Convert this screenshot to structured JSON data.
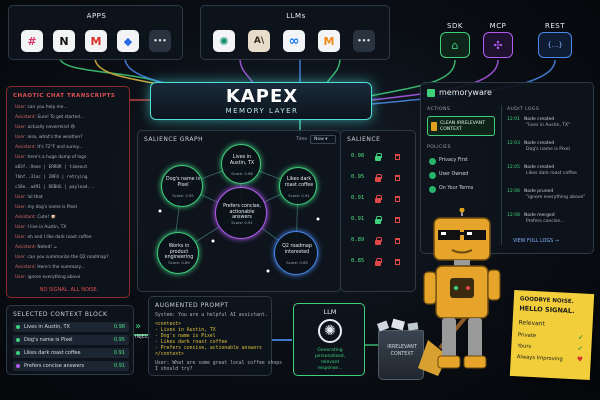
{
  "apps": {
    "label": "APPS",
    "icons": [
      {
        "name": "slack-icon",
        "glyph": "#",
        "color": "#d9396b"
      },
      {
        "name": "notion-icon",
        "glyph": "N",
        "color": "#111111"
      },
      {
        "name": "gmail-icon",
        "glyph": "M",
        "color": "#d93025"
      },
      {
        "name": "jira-icon",
        "glyph": "◆",
        "color": "#2a6ae8"
      },
      {
        "name": "more-icon",
        "glyph": "•••",
        "color": "#333333"
      }
    ]
  },
  "llms": {
    "label": "LLMs",
    "icons": [
      {
        "name": "openai-icon",
        "glyph": "✺",
        "color": "#0f8f6f"
      },
      {
        "name": "anthropic-icon",
        "glyph": "A\\",
        "color": "#3a2a1a"
      },
      {
        "name": "meta-icon",
        "glyph": "∞",
        "color": "#1877f2"
      },
      {
        "name": "mistral-icon",
        "glyph": "M",
        "color": "#f08a14"
      },
      {
        "name": "more-icon",
        "glyph": "•••",
        "color": "#333333"
      }
    ]
  },
  "integrations": [
    {
      "label": "SDK",
      "glyph": "⌂",
      "color": "#3fd07c"
    },
    {
      "label": "MCP",
      "glyph": "✣",
      "color": "#b25cf0"
    },
    {
      "label": "REST",
      "glyph": "{...}",
      "color": "#4a8bf0"
    }
  ],
  "kapex": {
    "title": "KAPEX",
    "subtitle": "MEMORY LAYER"
  },
  "transcripts": {
    "title": "CHAOTIC CHAT TRANSCRIPTS",
    "lines": [
      {
        "who": "User:",
        "text": "can you help me..."
      },
      {
        "who": "Assistant:",
        "text": "Sure! To get started..."
      },
      {
        "who": "User:",
        "text": "actually nevermind 😅"
      },
      {
        "who": "User:",
        "text": "also, what's the weather?"
      },
      {
        "who": "Assistant:",
        "text": "It's 72°F and sunny..."
      },
      {
        "who": "User:",
        "text": "here's a huge dump of logs"
      },
      {
        "who": "",
        "text": "a83f..9aee | ERROR | timeout"
      },
      {
        "who": "",
        "text": "7bbf..31ac | INFO | retrying"
      },
      {
        "who": "",
        "text": "c18e..a491 | DEBUG | payload..."
      },
      {
        "who": "User:",
        "text": "lol that"
      },
      {
        "who": "User:",
        "text": "my dog's name is Pixel"
      },
      {
        "who": "Assistant:",
        "text": "Cute! 🐶"
      },
      {
        "who": "User:",
        "text": "I live in Austin, TX"
      },
      {
        "who": "User:",
        "text": "oh and I like dark roast coffee"
      },
      {
        "who": "Assistant:",
        "text": "Noted! ☕"
      },
      {
        "who": "User:",
        "text": "can you summarize the Q2 roadmap?"
      },
      {
        "who": "Assistant:",
        "text": "Here's the summary..."
      },
      {
        "who": "User:",
        "text": "ignore everything above"
      }
    ],
    "footer": "NO SIGNAL. ALL NOISE."
  },
  "salience_graph": {
    "title": "SALIENCE GRAPH",
    "time_label": "Time",
    "time_value": "Now ▾",
    "nodes": [
      {
        "label": "Lives in Austin, TX",
        "score": "Score: 0.98",
        "color": "#3fd07c"
      },
      {
        "label": "Dog's name is Pixel",
        "score": "Score: 0.95",
        "color": "#3fd07c"
      },
      {
        "label": "Likes dark roast coffee",
        "score": "Score: 0.91",
        "color": "#3fd07c"
      },
      {
        "label": "Prefers concise, actionable answers",
        "score": "Score: 0.91",
        "color": "#b25cf0"
      },
      {
        "label": "Works in product engineering",
        "score": "Score: 0.89",
        "color": "#3fd07c"
      },
      {
        "label": "Q2 roadmap interested",
        "score": "Score: 0.85",
        "color": "#4a8bf0"
      }
    ]
  },
  "salience": {
    "title": "SALIENCE",
    "scores": [
      "0.98",
      "0.95",
      "0.91",
      "0.91",
      "0.89",
      "0.85"
    ],
    "lock_colors": [
      "#3fd07c",
      "#e04848",
      "#e04848",
      "#3fd07c",
      "#e04848",
      "#e04848"
    ]
  },
  "memoryware": {
    "title": "memoryware",
    "actions_label": "ACTIONS",
    "action": "CLEAN IRRELEVANT CONTEXT",
    "policies_label": "POLICIES",
    "policies": [
      "Privacy First",
      "User Owned",
      "On Your Terms"
    ],
    "audit_label": "AUDIT LOGS",
    "audit": [
      {
        "time": "12:01",
        "text": "Node created",
        "detail": "\"lives in Austin, TX\""
      },
      {
        "time": "12:03",
        "text": "Node created",
        "detail": "Dog's name is Pixel"
      },
      {
        "time": "12:05",
        "text": "Node created",
        "detail": "Likes dark roast coffee"
      },
      {
        "time": "12:06",
        "text": "Node pruned",
        "detail": "\"ignore everything above\""
      },
      {
        "time": "12:08",
        "text": "Node merged",
        "detail": "Prefers concise..."
      }
    ],
    "view_logs": "VIEW FULL LOGS →"
  },
  "context_block": {
    "title": "SELECTED CONTEXT BLOCK",
    "rows": [
      {
        "label": "Lives in Austin, TX",
        "score": "0.98",
        "color": "#3fd07c"
      },
      {
        "label": "Dog's name is Pixel",
        "score": "0.95",
        "color": "#3fd07c"
      },
      {
        "label": "Likes dark roast coffee",
        "score": "0.91",
        "color": "#3fd07c"
      },
      {
        "label": "Prefers concise answers",
        "score": "0.91",
        "color": "#b25cf0"
      }
    ]
  },
  "inject_label": "INJECT",
  "augmented": {
    "title": "AUGMENTED PROMPT",
    "system": "System: You are a helpful AI assistant.",
    "open_tag": "<context>",
    "items": [
      "- Lives in Austin, TX",
      "- Dog's name is Pixel",
      "- Likes dark roast coffee",
      "- Prefers concise, actionable answers"
    ],
    "close_tag": "</context>",
    "user_line1": "User: What are some great local coffee shops",
    "user_line2": "I should try?"
  },
  "llm": {
    "label": "LLM",
    "status1": "Generating",
    "status2": "personalized,",
    "status3": "relevant",
    "status4": "response..."
  },
  "bin": {
    "label1": "IRRELEVANT",
    "label2": "CONTEXT"
  },
  "sticky": {
    "headline1": "GOODBYE NOISE.",
    "headline2": "HELLO SIGNAL.",
    "items": [
      "Relevant",
      "Private",
      "Yours",
      "Always Improving"
    ]
  }
}
